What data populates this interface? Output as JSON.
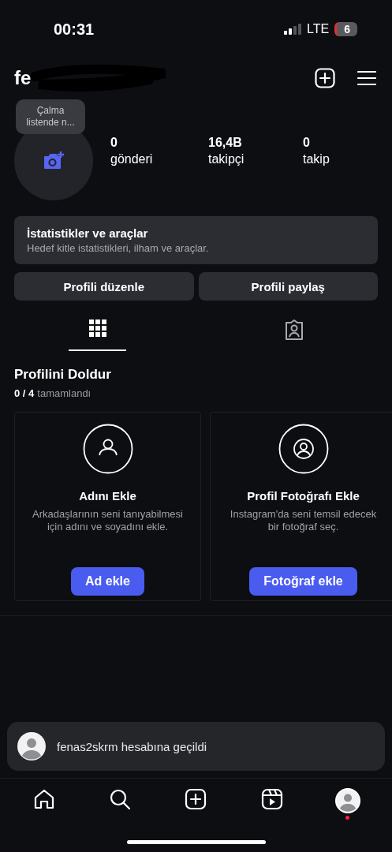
{
  "status_bar": {
    "time": "00:31",
    "network": "LTE",
    "battery": "6"
  },
  "header": {
    "username": "fe"
  },
  "profile": {
    "tooltip": "Çalma listende n...",
    "stats": [
      {
        "value": "0",
        "label": "gönderi"
      },
      {
        "value": "16,4B",
        "label": "takipçi"
      },
      {
        "value": "0",
        "label": "takip"
      }
    ]
  },
  "insights": {
    "title": "İstatistikler ve araçlar",
    "subtitle": "Hedef kitle istatistikleri, ilham ve araçlar."
  },
  "buttons": [
    "Profili düzenle",
    "Profili paylaş"
  ],
  "tabs": [
    {
      "kind": "grid",
      "selected": true
    },
    {
      "kind": "tagged",
      "selected": false
    }
  ],
  "complete_profile": {
    "title": "Profilini Doldur",
    "progress": "0 / 4",
    "progress_label": "tamamlandı",
    "cards": [
      {
        "kind": "name",
        "title": "Adını Ekle",
        "description": "Arkadaşlarının seni tanıyabilmesi için adını ve soyadını ekle.",
        "button": "Ad ekle"
      },
      {
        "kind": "photo",
        "title": "Profil Fotoğrafı Ekle",
        "description": "Instagram'da seni temsil edecek bir fotoğraf seç.",
        "button": "Fotoğraf ekle"
      }
    ]
  },
  "toast": {
    "text": "fenas2skrm hesabına geçildi"
  },
  "bottom_nav": [
    {
      "kind": "home",
      "selected": false,
      "badge": false
    },
    {
      "kind": "search",
      "selected": false,
      "badge": false
    },
    {
      "kind": "create",
      "selected": false,
      "badge": false
    },
    {
      "kind": "reels",
      "selected": false,
      "badge": false
    },
    {
      "kind": "profile",
      "selected": true,
      "badge": true
    }
  ]
}
